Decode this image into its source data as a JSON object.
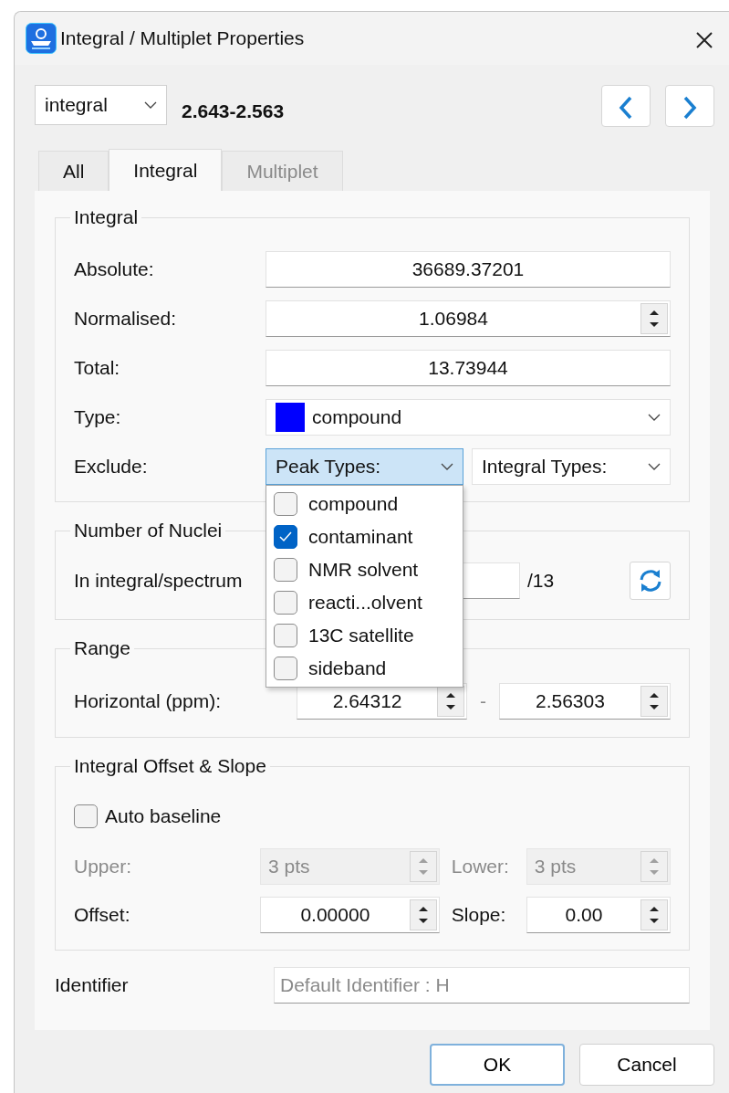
{
  "window": {
    "title": "Integral / Multiplet Properties"
  },
  "header": {
    "selector": {
      "value": "integral"
    },
    "range_label": "2.643-2.563"
  },
  "tabs": [
    {
      "label": "All",
      "selected": false,
      "disabled": false
    },
    {
      "label": "Integral",
      "selected": true,
      "disabled": false
    },
    {
      "label": "Multiplet",
      "selected": false,
      "disabled": true
    }
  ],
  "integral_group": {
    "title": "Integral",
    "fields": [
      {
        "label": "Absolute:",
        "value": "36689.37201",
        "kind": "text"
      },
      {
        "label": "Normalised:",
        "value": "1.06984",
        "kind": "spin"
      },
      {
        "label": "Total:",
        "value": "13.73944",
        "kind": "text"
      }
    ],
    "type": {
      "label": "Type:",
      "value": "compound",
      "color": "#0000ff"
    },
    "exclude": {
      "label": "Exclude:",
      "peak_types": {
        "label": "Peak Types:",
        "expanded": true
      },
      "integral_types": {
        "label": "Integral Types:"
      }
    }
  },
  "peak_types_menu": [
    {
      "label": "compound",
      "checked": false
    },
    {
      "label": "contaminant",
      "checked": true
    },
    {
      "label": "NMR solvent",
      "checked": false
    },
    {
      "label": "reacti...olvent",
      "checked": false
    },
    {
      "label": "13C satellite",
      "checked": false
    },
    {
      "label": "sideband",
      "checked": false
    }
  ],
  "nuclei_group": {
    "title": "Number of Nuclei",
    "label": "In integral/spectrum",
    "total": "/13"
  },
  "range_group": {
    "title": "Range",
    "label": "Horizontal (ppm):",
    "from": "2.64312",
    "separator": "-",
    "to": "2.56303"
  },
  "offset_group": {
    "title": "Integral Offset & Slope",
    "auto_baseline": {
      "label": "Auto baseline",
      "checked": false
    },
    "rows": [
      [
        {
          "label": "Upper:",
          "value": "3 pts",
          "disabled": true
        },
        {
          "label": "Lower:",
          "value": "3 pts",
          "disabled": true
        }
      ],
      [
        {
          "label": "Offset:",
          "value": "0.00000",
          "disabled": false
        },
        {
          "label": "Slope:",
          "value": "0.00",
          "disabled": false
        }
      ]
    ]
  },
  "identifier": {
    "label": "Identifier",
    "placeholder": "Default Identifier : H"
  },
  "buttons": [
    {
      "label": "OK",
      "default": true
    },
    {
      "label": "Cancel",
      "default": false
    }
  ]
}
